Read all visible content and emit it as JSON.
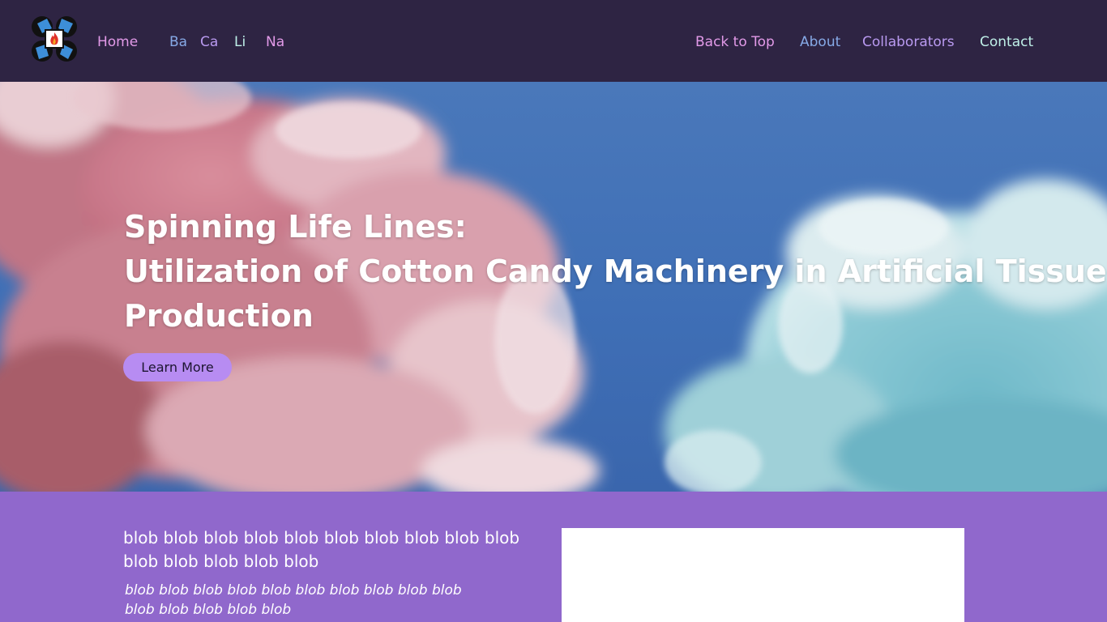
{
  "nav": {
    "logo_icon": "molecule-flame-logo-icon",
    "home": "Home",
    "elements": [
      "Ba",
      "Ca",
      "Li",
      "Na"
    ],
    "back_to_top": "Back to Top",
    "about": "About",
    "collaborators": "Collaborators",
    "contact": "Contact"
  },
  "hero": {
    "title_line1": "Spinning Life Lines:",
    "title_line2": "Utilization of Cotton Candy Machinery in Artificial Tissue",
    "title_line3": "Production",
    "button": "Learn More",
    "background_icon": "cotton-candy-photo"
  },
  "content": {
    "paragraph": "blob blob blob blob blob blob blob blob blob blob blob blob blob blob blob",
    "subtext": "blob blob blob blob blob blob blob blob blob blob blob blob blob blob blob"
  },
  "colors": {
    "nav_bg": "#2e2443",
    "link_pink": "#e29ae8",
    "link_blue": "#86a9e6",
    "link_purple": "#b99af0",
    "link_mint": "#bff0e8",
    "button_bg": "#b78cf2",
    "content_bg": "#9068cc"
  }
}
